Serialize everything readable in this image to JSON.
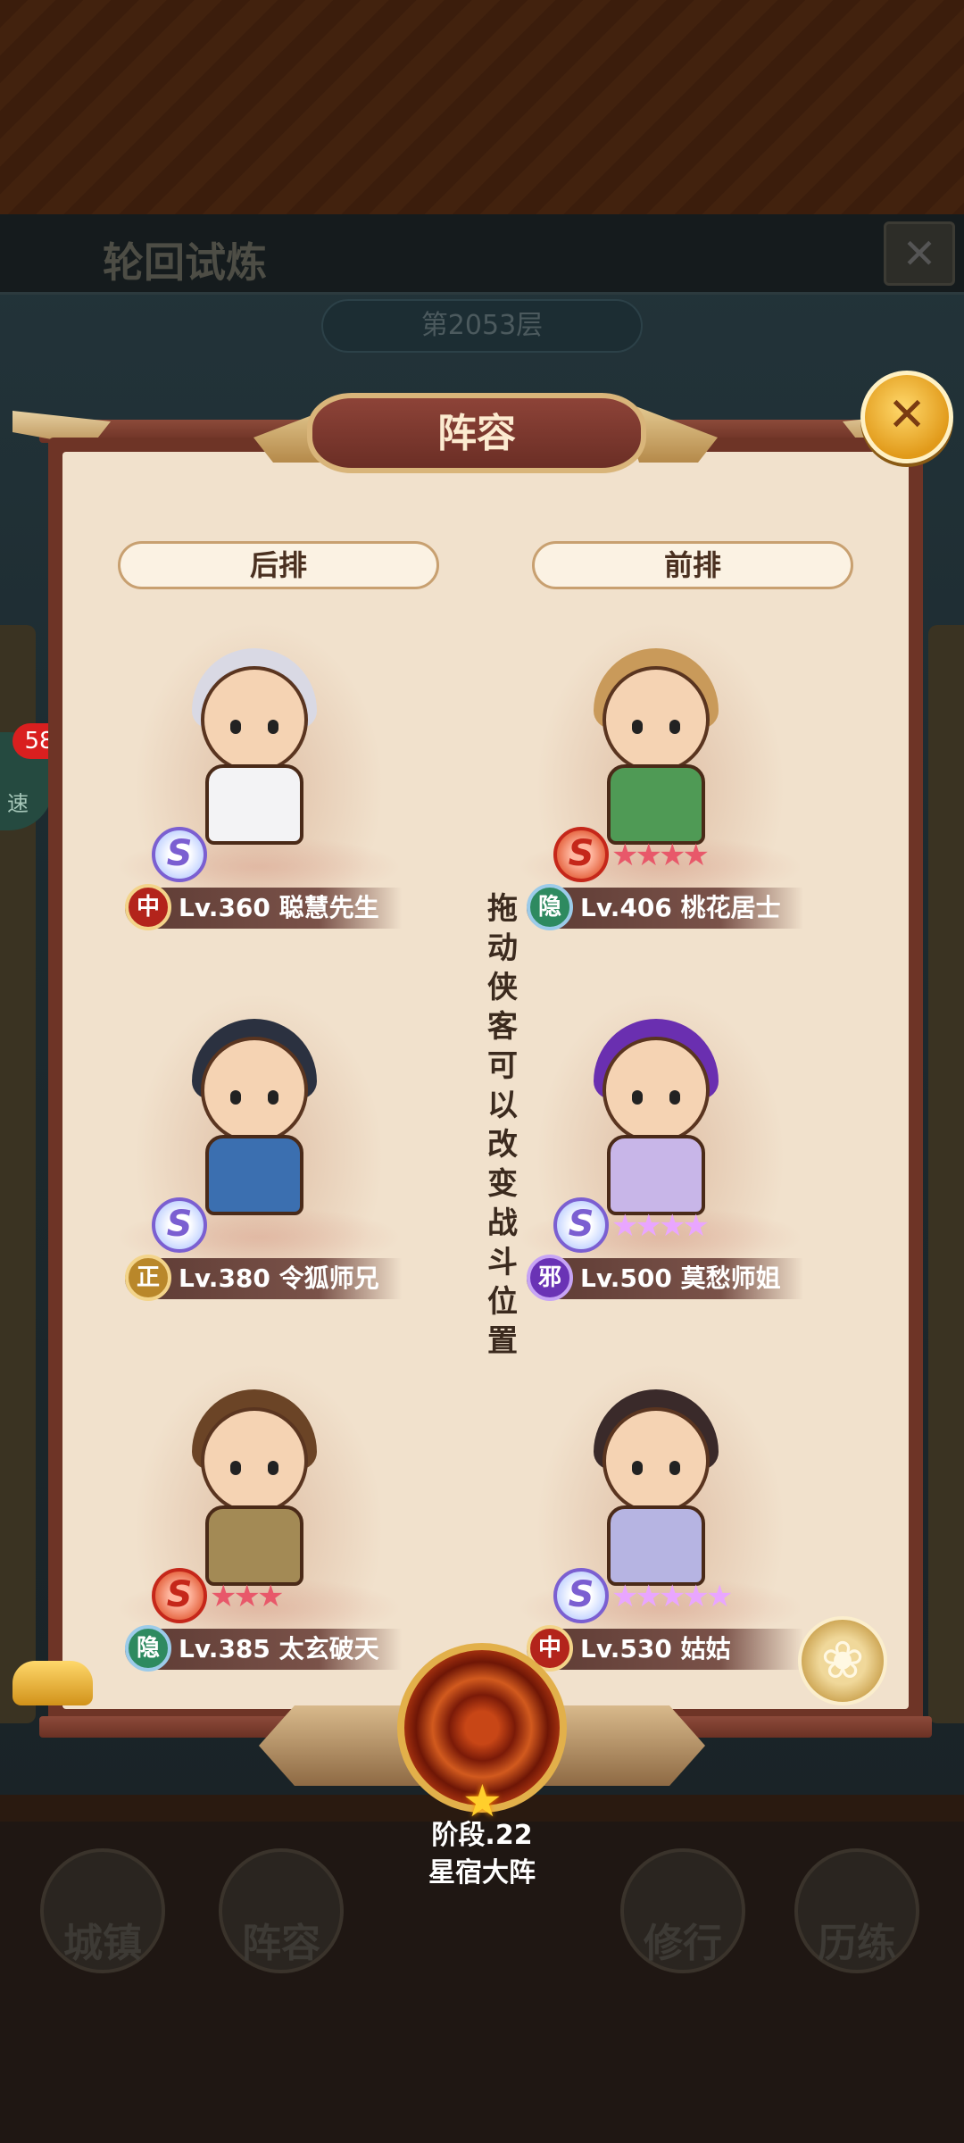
{
  "background_screen": {
    "title": "轮回试炼",
    "floor": "第2053层",
    "close_icon": "✕",
    "speed_count": "58",
    "speed_label": "速",
    "nav": [
      {
        "label": "城镇"
      },
      {
        "label": "阵容"
      },
      {
        "label": ""
      },
      {
        "label": "修行"
      },
      {
        "label": "历练"
      }
    ]
  },
  "dialog": {
    "title": "阵容",
    "close_icon": "✕",
    "back_row_label": "后排",
    "front_row_label": "前排",
    "hint": "拖动侠客可以改变战斗位置",
    "flower_icon": "❀"
  },
  "heroes": [
    {
      "slot": "back-1",
      "faction": "中",
      "level_name": "Lv.360 聪慧先生",
      "tier": "S",
      "tier_color": "purple",
      "stars": 0,
      "star_color": ""
    },
    {
      "slot": "front-1",
      "faction": "隐",
      "level_name": "Lv.406 桃花居士",
      "tier": "S",
      "tier_color": "red",
      "stars": 4,
      "star_color": "red"
    },
    {
      "slot": "back-2",
      "faction": "正",
      "level_name": "Lv.380 令狐师兄",
      "tier": "S",
      "tier_color": "purple",
      "stars": 0,
      "star_color": ""
    },
    {
      "slot": "front-2",
      "faction": "邪",
      "level_name": "Lv.500 莫愁师姐",
      "tier": "S",
      "tier_color": "purple",
      "stars": 4,
      "star_color": "pink"
    },
    {
      "slot": "back-3",
      "faction": "隐",
      "level_name": "Lv.385 太玄破天",
      "tier": "S",
      "tier_color": "red",
      "stars": 3,
      "star_color": "red"
    },
    {
      "slot": "front-3",
      "faction": "中",
      "level_name": "Lv.530 姑姑",
      "tier": "S",
      "tier_color": "purple",
      "stars": 5,
      "star_color": "pink"
    }
  ],
  "formation": {
    "stage": "阶段.22",
    "name": "星宿大阵"
  },
  "colors": {
    "accent_gold": "#e2b04a",
    "frame_red": "#6e3426",
    "paper": "#f1e1cc"
  }
}
